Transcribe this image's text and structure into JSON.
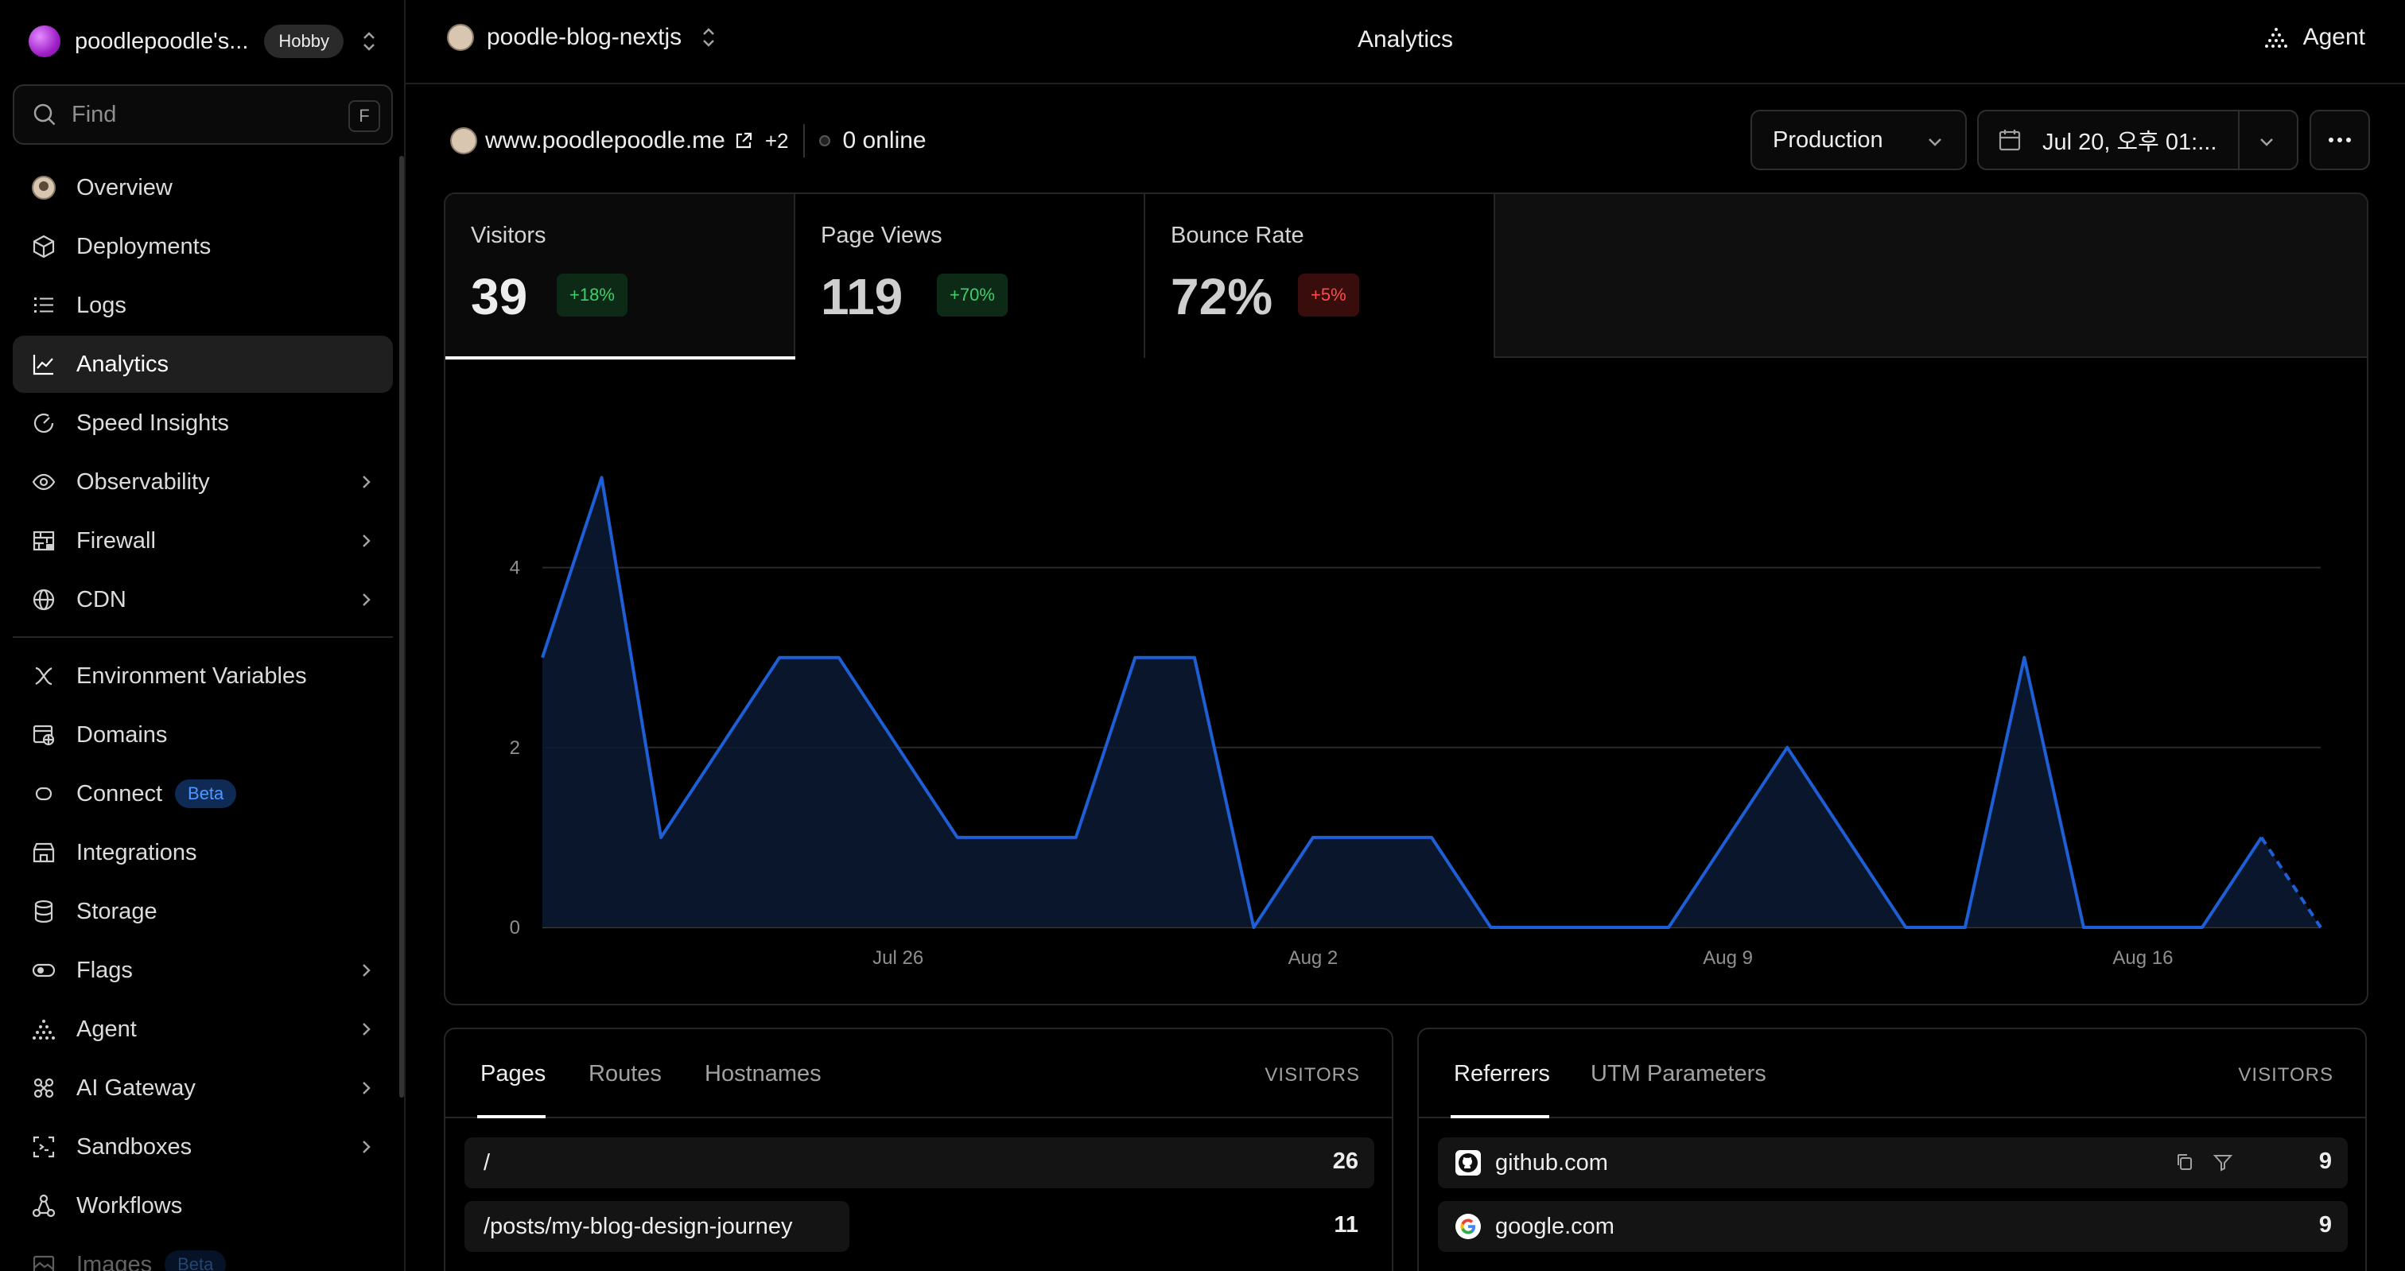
{
  "team": {
    "name": "poodlepoodle's...",
    "plan": "Hobby"
  },
  "search": {
    "placeholder": "Find",
    "shortcut": "F"
  },
  "sidebar": {
    "items": [
      {
        "label": "Overview"
      },
      {
        "label": "Deployments"
      },
      {
        "label": "Logs"
      },
      {
        "label": "Analytics"
      },
      {
        "label": "Speed Insights"
      },
      {
        "label": "Observability"
      },
      {
        "label": "Firewall"
      },
      {
        "label": "CDN"
      },
      {
        "label": "Environment Variables"
      },
      {
        "label": "Domains"
      },
      {
        "label": "Connect",
        "badge": "Beta"
      },
      {
        "label": "Integrations"
      },
      {
        "label": "Storage"
      },
      {
        "label": "Flags"
      },
      {
        "label": "Agent"
      },
      {
        "label": "AI Gateway"
      },
      {
        "label": "Sandboxes"
      },
      {
        "label": "Workflows"
      },
      {
        "label": "Images",
        "badge": "Beta"
      }
    ]
  },
  "header": {
    "project": "poodle-blog-nextjs",
    "title": "Analytics",
    "agent_label": "Agent"
  },
  "domain": {
    "name": "www.poodlepoodle.me",
    "extra": "+2",
    "online": "0 online"
  },
  "filters": {
    "environment": "Production",
    "date_range": "Jul 20, 오후 01:..."
  },
  "stats": [
    {
      "label": "Visitors",
      "value": "39",
      "change": "+18%",
      "trend": "up"
    },
    {
      "label": "Page Views",
      "value": "119",
      "change": "+70%",
      "trend": "up"
    },
    {
      "label": "Bounce Rate",
      "value": "72%",
      "change": "+5%",
      "trend": "down"
    }
  ],
  "chart_data": {
    "type": "area",
    "series": [
      {
        "values": [
          3,
          5,
          1,
          2,
          3,
          3,
          2,
          1,
          1,
          1,
          3,
          3,
          0,
          1,
          1,
          1,
          0,
          0,
          0,
          0,
          1,
          2,
          1,
          0,
          0,
          3,
          0,
          0,
          0,
          1,
          0
        ]
      }
    ],
    "x": [
      "Jul 20",
      "Jul 21",
      "Jul 22",
      "Jul 23",
      "Jul 24",
      "Jul 25",
      "Jul 26",
      "Jul 27",
      "Jul 28",
      "Jul 29",
      "Jul 30",
      "Jul 31",
      "Aug 1",
      "Aug 2",
      "Aug 3",
      "Aug 4",
      "Aug 5",
      "Aug 6",
      "Aug 7",
      "Aug 8",
      "Aug 9",
      "Aug 10",
      "Aug 11",
      "Aug 12",
      "Aug 13",
      "Aug 14",
      "Aug 15",
      "Aug 16",
      "Aug 17",
      "Aug 18",
      "Aug 19"
    ],
    "xticks": [
      "Jul 26",
      "Aug 2",
      "Aug 9",
      "Aug 16"
    ],
    "yticks": [
      "0",
      "2",
      "4"
    ],
    "ylim": [
      0,
      5.8
    ],
    "grid": true,
    "last_segment_dashed": true,
    "color": "#1f5fd6"
  },
  "pages_card": {
    "tabs": [
      "Pages",
      "Routes",
      "Hostnames"
    ],
    "column": "VISITORS",
    "rows": [
      {
        "label": "/",
        "value": "26"
      },
      {
        "label": "/posts/my-blog-design-journey",
        "value": "11"
      }
    ]
  },
  "referrers_card": {
    "tabs": [
      "Referrers",
      "UTM Parameters"
    ],
    "column": "VISITORS",
    "rows": [
      {
        "label": "github.com",
        "value": "9",
        "icon": "github-icon"
      },
      {
        "label": "google.com",
        "value": "9",
        "icon": "google-icon"
      }
    ]
  },
  "colors": {
    "accent": "#1f5fd6",
    "positive": "#3ecf6b",
    "negative": "#ff4b4b"
  }
}
